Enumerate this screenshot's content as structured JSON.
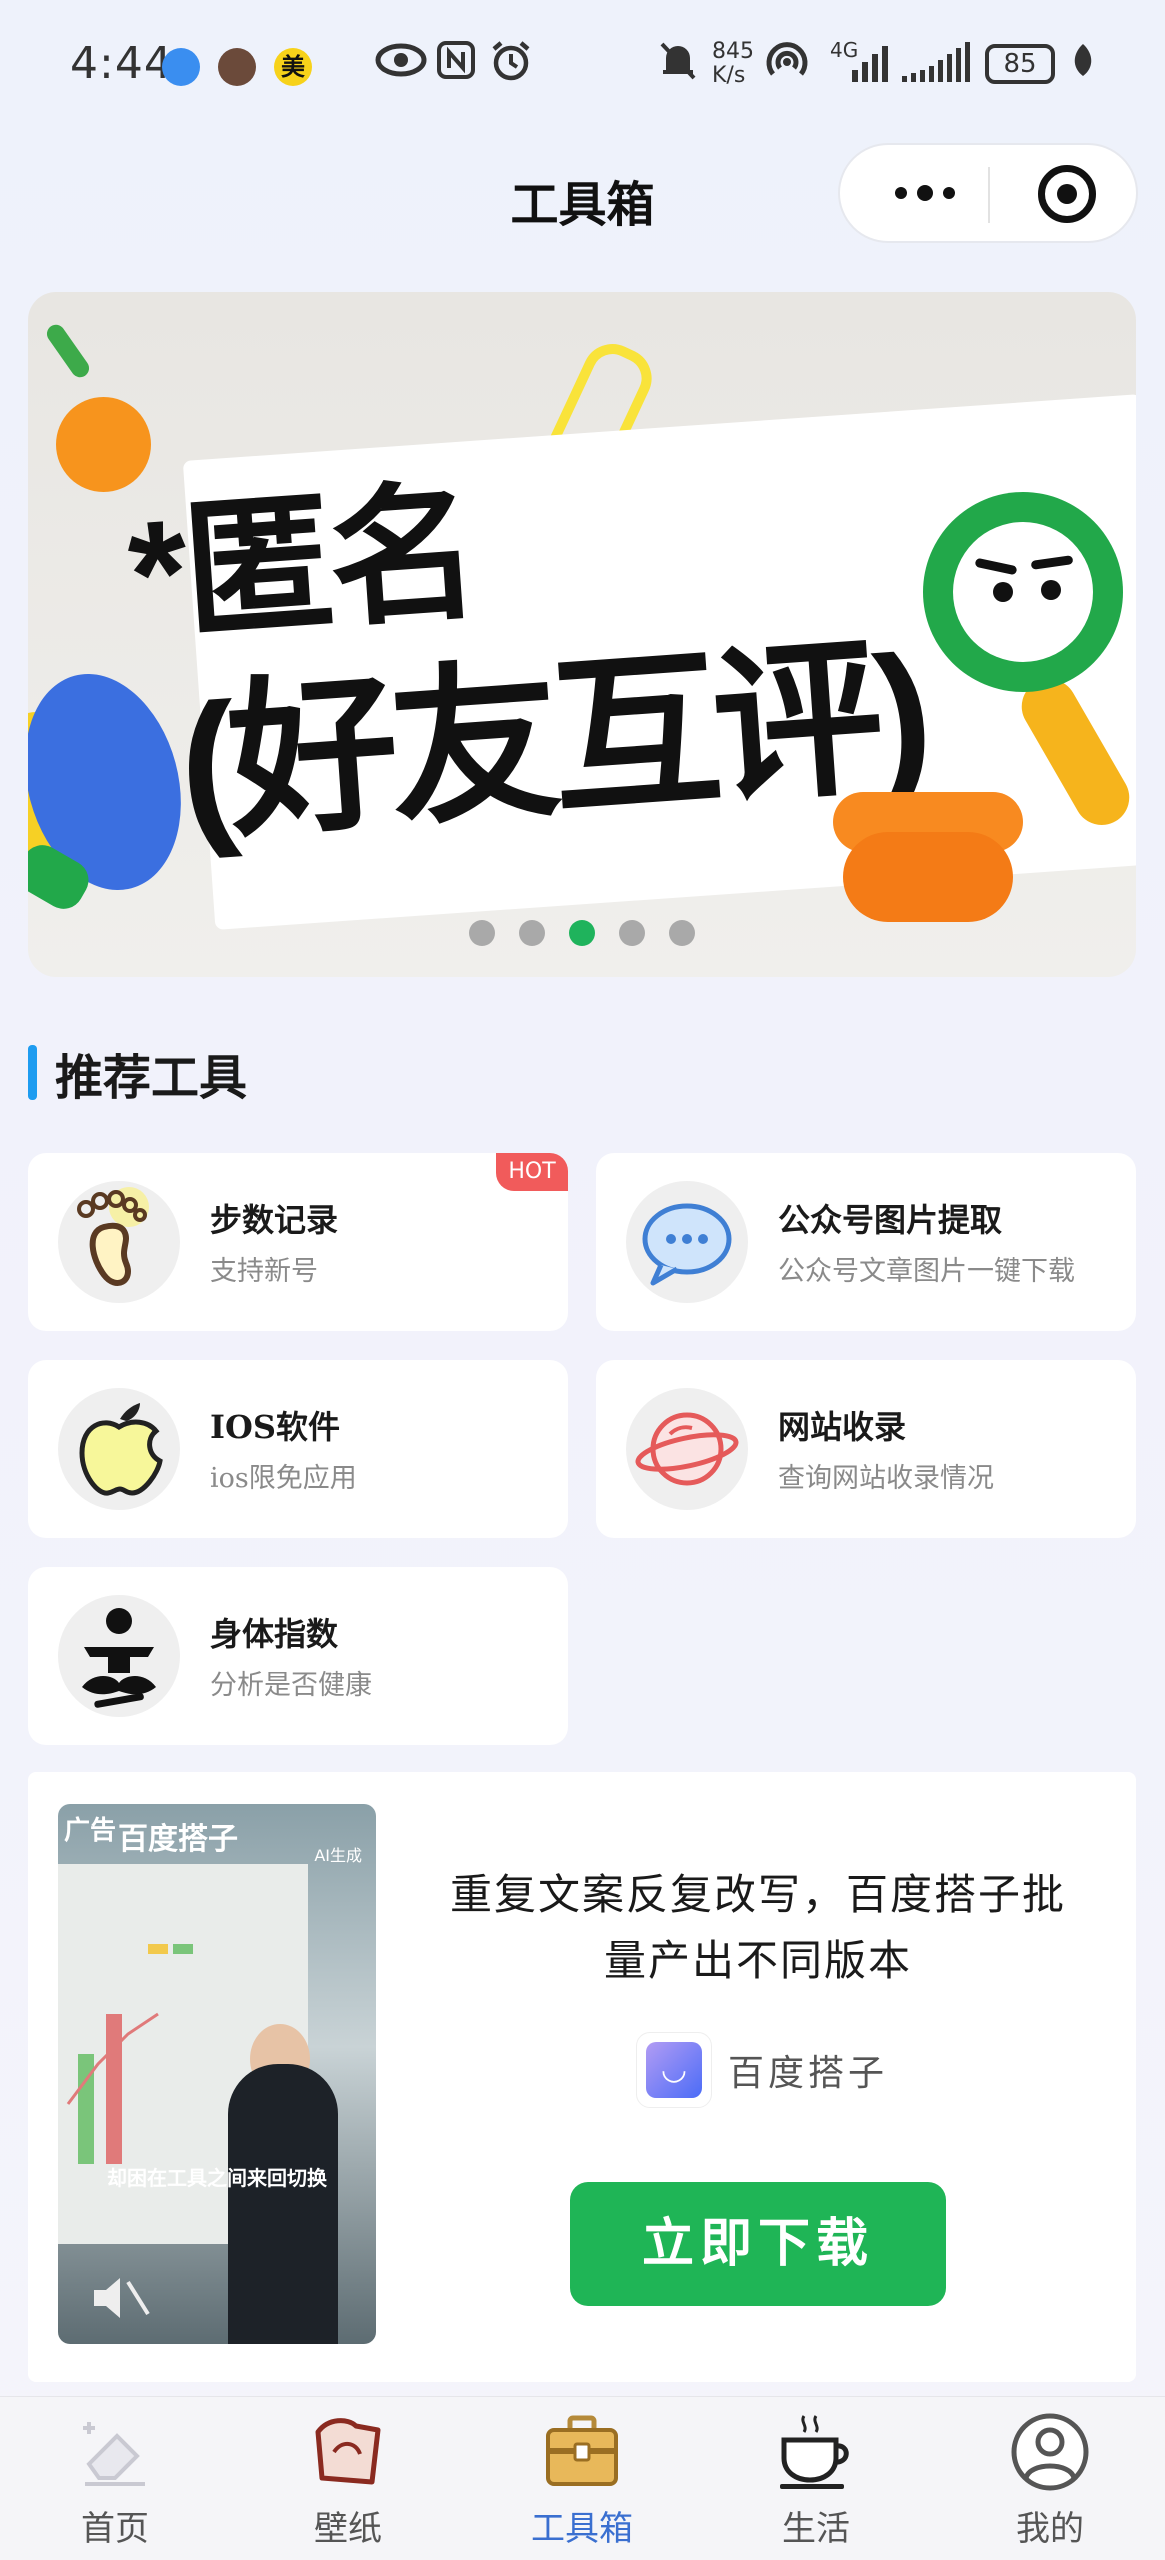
{
  "status_bar": {
    "time": "4:44",
    "app_badge": "美",
    "net_speed_value": "845",
    "net_speed_unit": "K/s",
    "network": "4G",
    "battery": "85"
  },
  "navbar": {
    "title": "工具箱"
  },
  "banner": {
    "headline_line1": "*匿名",
    "headline_line2": "(好友互评)",
    "slide_count": 5,
    "active_slide": 3
  },
  "section": {
    "title": "推荐工具"
  },
  "tools": [
    {
      "name": "步数记录",
      "desc": "支持新号",
      "badge": "HOT",
      "icon": "footprint-icon"
    },
    {
      "name": "公众号图片提取",
      "desc": "公众号文章图片一键下载",
      "icon": "chat-bubble-icon"
    },
    {
      "name": "IOS软件",
      "desc": "ios限免应用",
      "icon": "apple-icon"
    },
    {
      "name": "网站收录",
      "desc": "查询网站收录情况",
      "icon": "planet-icon"
    },
    {
      "name": "身体指数",
      "desc": "分析是否健康",
      "icon": "meditation-icon"
    }
  ],
  "ad": {
    "tag": "广告",
    "video_brand": "百度搭子",
    "video_ai_label": "AI生成",
    "video_caption": "却困在工具之间来回切换",
    "headline": "重复文案反复改写，百度搭子批量产出不同版本",
    "brand": "百度搭子",
    "button": "立即下载"
  },
  "tabbar": {
    "items": [
      {
        "label": "首页",
        "icon": "home-eraser-icon"
      },
      {
        "label": "壁纸",
        "icon": "wallpaper-icon"
      },
      {
        "label": "工具箱",
        "icon": "toolbox-icon",
        "active": true
      },
      {
        "label": "生活",
        "icon": "coffee-cup-icon"
      },
      {
        "label": "我的",
        "icon": "user-icon"
      }
    ],
    "active_color": "#3a6fd0"
  },
  "colors": {
    "accent_green": "#1fb556",
    "section_bar": "#1e9cf0",
    "hot_badge": "#f15b5b"
  }
}
